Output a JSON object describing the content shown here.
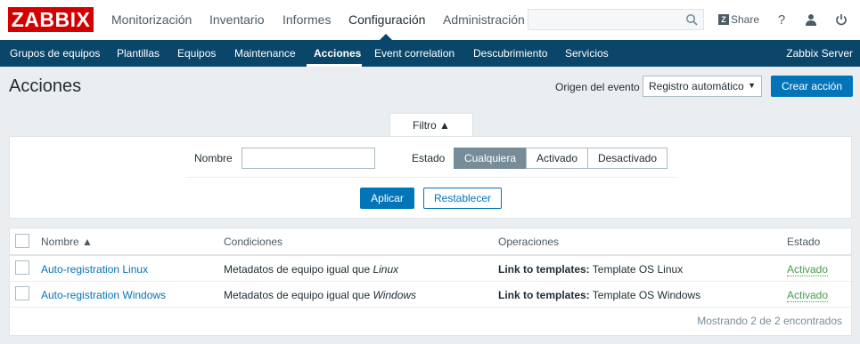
{
  "header": {
    "logo": "ZABBIX",
    "nav": [
      "Monitorización",
      "Inventario",
      "Informes",
      "Configuración",
      "Administración"
    ],
    "active_nav": "Configuración",
    "search_placeholder": "",
    "share": "Share",
    "help_icon": "help-icon",
    "user_icon": "user-icon",
    "logout_icon": "power-icon"
  },
  "subnav": {
    "items": [
      "Grupos de equipos",
      "Plantillas",
      "Equipos",
      "Maintenance",
      "Acciones",
      "Event correlation",
      "Descubrimiento",
      "Servicios"
    ],
    "active": "Acciones",
    "server": "Zabbix Server"
  },
  "page": {
    "title": "Acciones",
    "origin_label": "Origen del evento",
    "origin_value": "Registro automático",
    "create_button": "Crear acción"
  },
  "filter": {
    "tab_label": "Filtro ▲",
    "name_label": "Nombre",
    "name_value": "",
    "state_label": "Estado",
    "state_options": [
      "Cualquiera",
      "Activado",
      "Desactivado"
    ],
    "state_selected": "Cualquiera",
    "apply": "Aplicar",
    "reset": "Restablecer"
  },
  "table": {
    "columns": [
      "Nombre ▲",
      "Condiciones",
      "Operaciones",
      "Estado"
    ],
    "rows": [
      {
        "name": "Auto-registration Linux",
        "cond_prefix": "Metadatos de equipo igual que ",
        "cond_value": "Linux",
        "op_prefix": "Link to templates:",
        "op_value": " Template OS Linux",
        "status": "Activado"
      },
      {
        "name": "Auto-registration Windows",
        "cond_prefix": "Metadatos de equipo igual que ",
        "cond_value": "Windows",
        "op_prefix": "Link to templates:",
        "op_value": " Template OS Windows",
        "status": "Activado"
      }
    ],
    "footer": "Mostrando 2 de 2 encontrados"
  },
  "colors": {
    "brand": "#d40000",
    "nav_bg": "#0a466a",
    "primary": "#0275b8",
    "status_green": "#429e47"
  }
}
